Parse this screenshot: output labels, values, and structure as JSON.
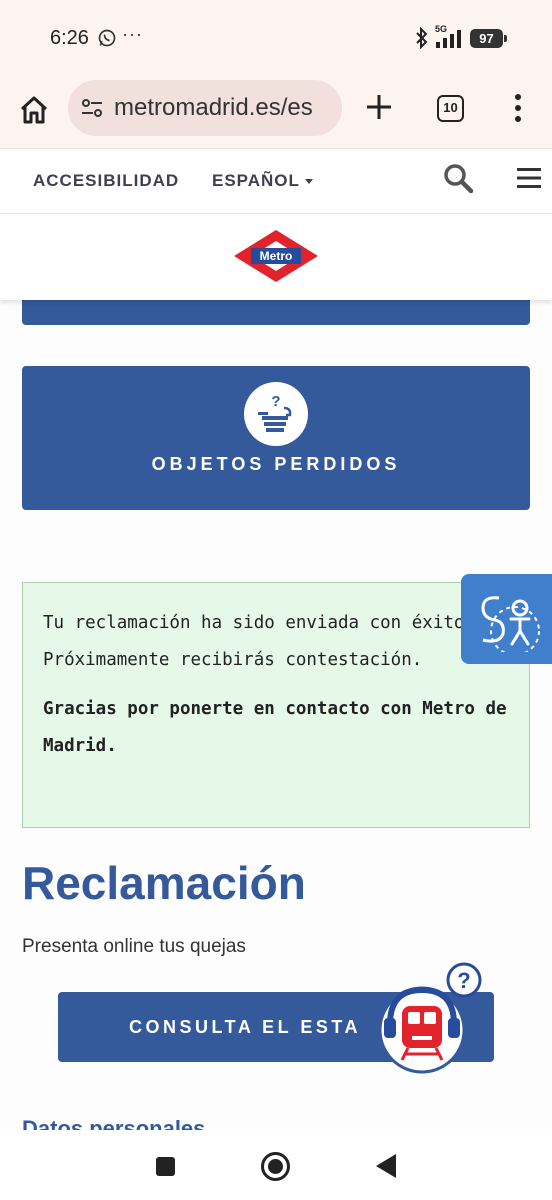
{
  "status_bar": {
    "time": "6:26",
    "overflow": "···",
    "network": "5G",
    "battery": "97",
    "icons": [
      "whatsapp-icon",
      "bluetooth-icon",
      "signal-icon",
      "battery-icon"
    ]
  },
  "browser": {
    "url": "metromadrid.es/es",
    "tab_count": "10",
    "icons": [
      "home-icon",
      "site-settings-icon",
      "new-tab-icon",
      "tab-switcher-icon",
      "more-options-icon"
    ]
  },
  "site_nav": {
    "accessibility": "ACCESIBILIDAD",
    "language": "ESPAÑOL",
    "icons": [
      "search-icon",
      "hamburger-menu-icon"
    ]
  },
  "logo": {
    "text": "Metro",
    "colors": {
      "red": "#e3232b",
      "blue": "#264c9b"
    }
  },
  "lost_items": {
    "label": "OBJETOS PERDIDOS",
    "icon": "lost-items-icon"
  },
  "success_message": {
    "line1": "Tu reclamación ha sido enviada con éxito. Próximamente recibirás contestación.",
    "line2": "Gracias por ponerte en contacto con Metro de Madrid."
  },
  "page": {
    "title": "Reclamación",
    "subtitle": "Presenta online tus quejas",
    "consult_button": "CONSULTA EL ESTA",
    "next_section": "Datos personales"
  },
  "colors": {
    "brand_blue": "#345a9c",
    "success_bg": "#e6f8e8",
    "widget_blue": "#3f7fcc"
  }
}
